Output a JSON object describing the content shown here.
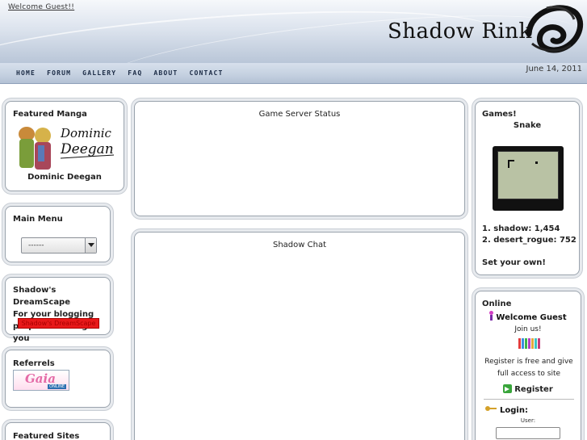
{
  "header": {
    "welcome": "Welcome Guest!!",
    "site_title": "Shadow Rink",
    "date": "June 14, 2011"
  },
  "nav": {
    "items": [
      "HOME",
      "FORUM",
      "GALLERY",
      "FAQ",
      "ABOUT",
      "CONTACT"
    ]
  },
  "left": {
    "featured_manga": {
      "title": "Featured Manga",
      "name": "Dominic Deegan"
    },
    "main_menu": {
      "title": "Main Menu",
      "selected": "------"
    },
    "dreamscape": {
      "line1": "Shadow's DreamScape",
      "line2": "For your blogging",
      "line3": "purposes I bring to you",
      "link": "Shadow's DreamScape"
    },
    "referrals": {
      "title": "Referrels",
      "banner_text": "Gaia",
      "banner_sub": "ONLINE"
    },
    "featured_sites": {
      "title": "Featured Sites"
    }
  },
  "center": {
    "server_status_title": "Game Server Status",
    "chat_title": "Shadow Chat"
  },
  "right": {
    "games": {
      "title": "Games!",
      "game_name": "Snake",
      "score1": "1. shadow: 1,454",
      "score2": "2. desert_rogue: 752",
      "set_own": "Set your own!"
    },
    "online": {
      "title": "Online",
      "welcome_guest": "Welcome Guest",
      "join_us": "Join us!",
      "register_text": "Register is free and give full access to site",
      "register_link": "Register",
      "login_label": "Login:",
      "user_label": "User:"
    }
  },
  "colors": {
    "dreamscape_link_bg": "#e8191a",
    "register_icon": "#39a53b",
    "guest_icon": "#d23fc4"
  }
}
